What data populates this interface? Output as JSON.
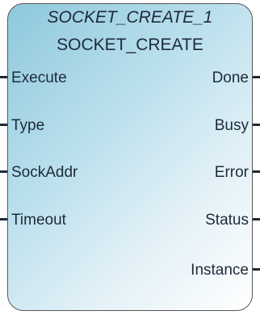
{
  "block": {
    "instance_name": "SOCKET_CREATE_1",
    "type_name": "SOCKET_CREATE",
    "inputs": [
      "Execute",
      "Type",
      "SockAddr",
      "Timeout"
    ],
    "outputs": [
      "Done",
      "Busy",
      "Error",
      "Status",
      "Instance"
    ]
  }
}
